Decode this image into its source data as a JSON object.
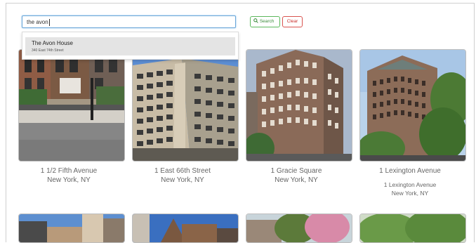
{
  "search": {
    "value": "the avon"
  },
  "buttons": {
    "search_label": "Search",
    "clear_label": "Clear"
  },
  "suggestion": {
    "title": "The Avon House",
    "subtitle": "340 East 74th Street"
  },
  "buildings": [
    {
      "name": "1 1/2 Fifth Avenue",
      "city": "New York, NY"
    },
    {
      "name": "1 East 66th Street",
      "city": "New York, NY"
    },
    {
      "name": "1 Gracie Square",
      "city": "New York, NY"
    },
    {
      "name": "1 Lexington Avenue",
      "city": "1 Lexington Avenue",
      "city2": "New York, NY"
    }
  ],
  "colors": {
    "search_green": "#5cb85c",
    "clear_red": "#d9534f",
    "input_focus": "#66afe9"
  },
  "icons": {
    "search": "magnifier-icon"
  }
}
